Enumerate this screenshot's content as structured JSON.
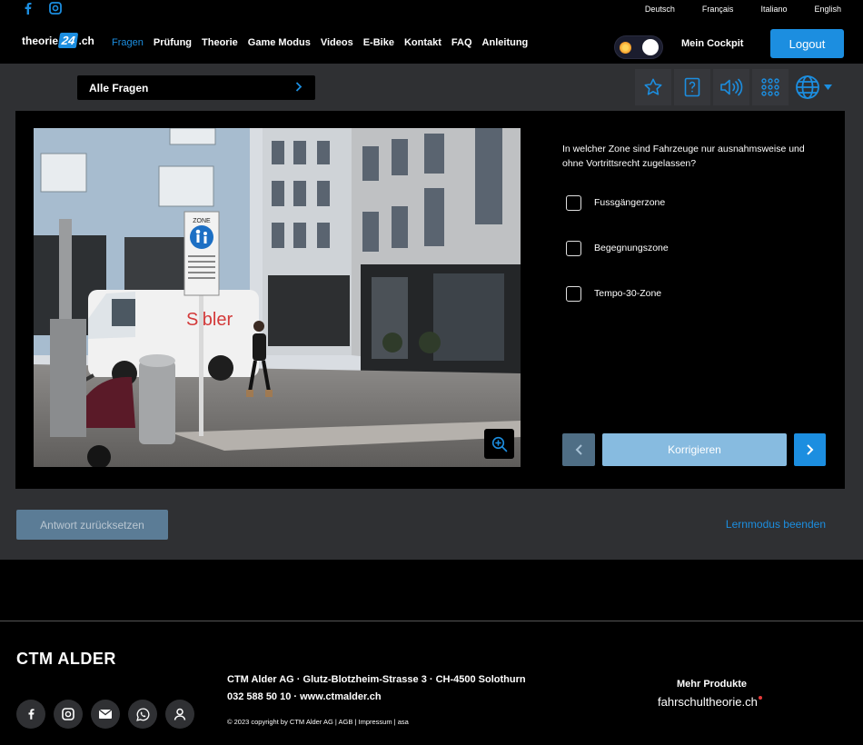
{
  "top": {
    "languages": [
      "Deutsch",
      "Français",
      "Italiano",
      "English"
    ]
  },
  "nav": {
    "logo_prefix": "theorie",
    "logo_badge": "24",
    "logo_suffix": ".ch",
    "menu": [
      "Fragen",
      "Prüfung",
      "Theorie",
      "Game Modus",
      "Videos",
      "E-Bike",
      "Kontakt",
      "FAQ",
      "Anleitung"
    ],
    "cockpit": "Mein Cockpit",
    "logout": "Logout"
  },
  "question_select": {
    "label": "Alle Fragen"
  },
  "question": {
    "text": "In welcher Zone sind Fahrzeuge nur ausnahmsweise und ohne Vortrittsrecht zugelassen?",
    "options": [
      "Fussgängerzone",
      "Begegnungszone",
      "Tempo-30-Zone"
    ],
    "check_label": "Korrigieren"
  },
  "photo": {
    "van_text": "Sibler",
    "sign_text": "ZONE"
  },
  "actions": {
    "reset": "Antwort zurücksetzen",
    "quit": "Lernmodus beenden"
  },
  "footer": {
    "brand": "CTM ALDER",
    "address": "CTM Alder AG · Glutz-Blotzheim-Strasse 3 · CH-4500 Solothurn",
    "contact": "032 588 50 10 · www.ctmalder.ch",
    "copyright": "© 2023 copyright by CTM Alder AG | AGB | Impressum | asa",
    "more_products": "Mehr Produkte",
    "site": "fahrschultheorie.ch"
  },
  "colors": {
    "accent": "#1c8ee0",
    "background": "#2f3033"
  }
}
